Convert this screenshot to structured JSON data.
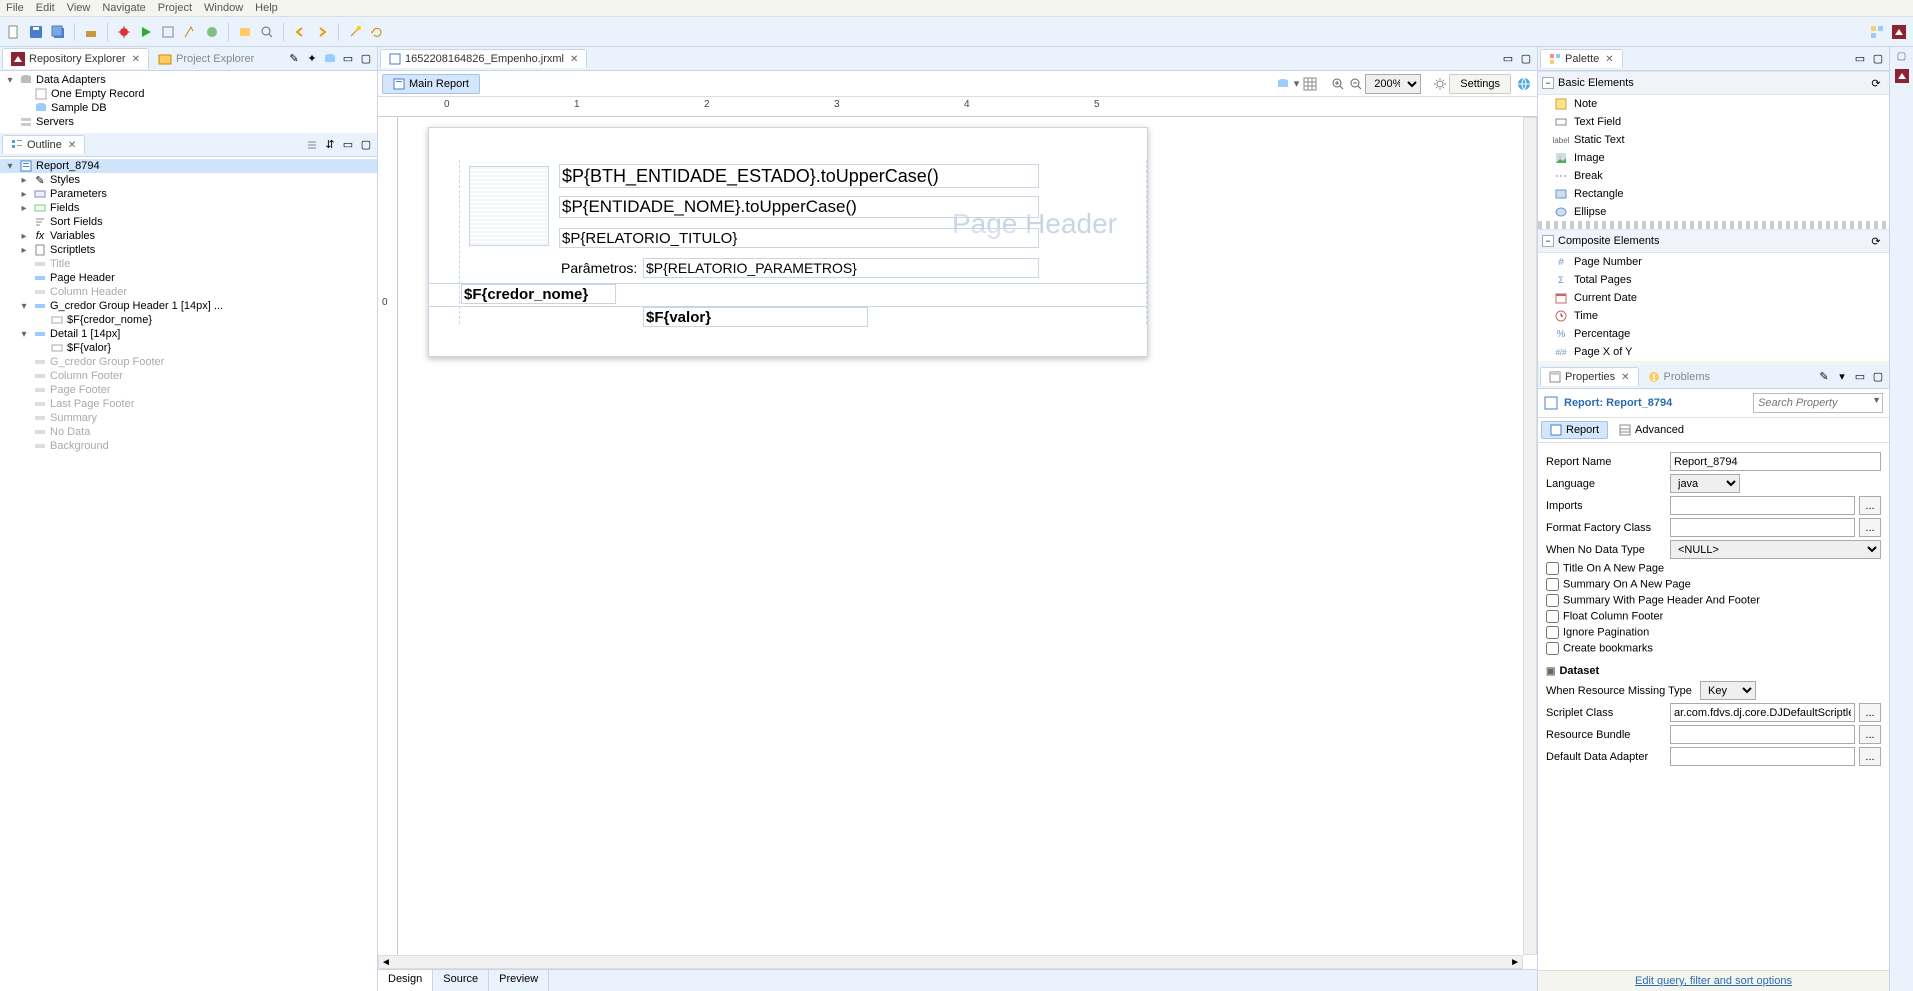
{
  "menubar": [
    "File",
    "Edit",
    "View",
    "Navigate",
    "Project",
    "Window",
    "Help"
  ],
  "left": {
    "repoTab": "Repository Explorer",
    "projTab": "Project Explorer",
    "dataAdapters": "Data Adapters",
    "oneEmpty": "One Empty Record",
    "sampleDb": "Sample DB",
    "servers": "Servers",
    "outlineTab": "Outline",
    "report": "Report_8794",
    "styles": "Styles",
    "parameters": "Parameters",
    "fields": "Fields",
    "sortFields": "Sort Fields",
    "variables": "Variables",
    "scriptlets": "Scriptlets",
    "title": "Title",
    "pageHeader": "Page Header",
    "columnHeader": "Column Header",
    "groupHeader": "G_credor Group Header 1 [14px] ...",
    "ghField": "$F{credor_nome}",
    "detail": "Detail 1 [14px]",
    "dField": "$F{valor}",
    "groupFooter": "G_credor Group Footer",
    "columnFooter": "Column Footer",
    "pageFooter": "Page Footer",
    "lastPageFooter": "Last Page Footer",
    "summary": "Summary",
    "noData": "No Data",
    "background": "Background"
  },
  "editor": {
    "filename": "1652208164826_Empenho.jrxml",
    "mainReport": "Main Report",
    "zoom": "200%",
    "settings": "Settings",
    "watermark": "Page Header",
    "f1": "$P{BTH_ENTIDADE_ESTADO}.toUpperCase()",
    "f2": "$P{ENTIDADE_NOME}.toUpperCase()",
    "f3": "$P{RELATORIO_TITULO}",
    "f4lbl": "Parâmetros:",
    "f4": "$P{RELATORIO_PARAMETROS}",
    "f5": "$F{credor_nome}",
    "f6": "$F{valor}",
    "botTabs": [
      "Design",
      "Source",
      "Preview"
    ]
  },
  "palette": {
    "tab": "Palette",
    "basic": "Basic Elements",
    "items1": [
      "Note",
      "Text Field",
      "Static Text",
      "Image",
      "Break",
      "Rectangle",
      "Ellipse"
    ],
    "comp": "Composite Elements",
    "items2": [
      "Page Number",
      "Total Pages",
      "Current Date",
      "Time",
      "Percentage",
      "Page X of Y"
    ]
  },
  "props": {
    "propertiesTab": "Properties",
    "problemsTab": "Problems",
    "title": "Report: Report_8794",
    "searchPH": "Search Property",
    "tabReport": "Report",
    "tabAdvanced": "Advanced",
    "lblReportName": "Report Name",
    "valReportName": "Report_8794",
    "lblLanguage": "Language",
    "valLanguage": "java",
    "lblImports": "Imports",
    "lblFFC": "Format Factory Class",
    "lblNoData": "When No Data Type",
    "valNoData": "<NULL>",
    "chk1": "Title On A New Page",
    "chk2": "Summary On A New Page",
    "chk3": "Summary With Page Header And Footer",
    "chk4": "Float Column Footer",
    "chk5": "Ignore Pagination",
    "chk6": "Create bookmarks",
    "dsHeader": "Dataset",
    "lblResMissing": "When Resource Missing Type",
    "valResMissing": "Key",
    "lblScriptlet": "Scriplet Class",
    "valScriptlet": "ar.com.fdvs.dj.core.DJDefaultScriptlet",
    "lblResBundle": "Resource Bundle",
    "lblDefAdapter": "Default Data Adapter",
    "editQuery": "Edit query, filter and sort options"
  }
}
